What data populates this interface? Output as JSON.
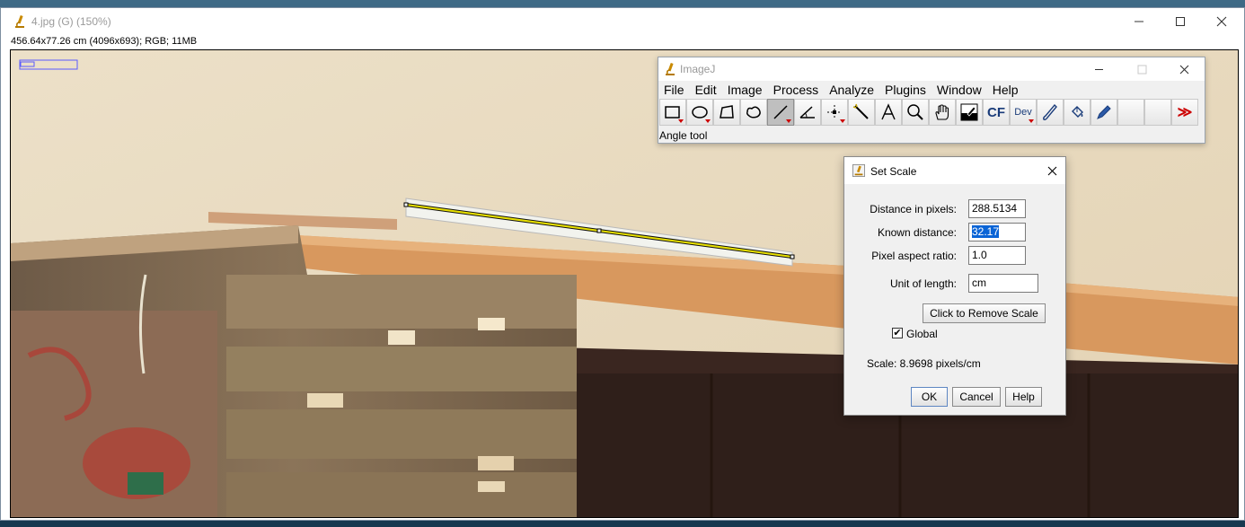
{
  "main_window": {
    "title": "4.jpg (G) (150%)",
    "image_info": "456.64x77.26 cm (4096x693); RGB; 11MB",
    "controls": {
      "minimize": "—",
      "maximize": "☐",
      "close": "✕"
    }
  },
  "imagej_window": {
    "title": "ImageJ",
    "menu": [
      "File",
      "Edit",
      "Image",
      "Process",
      "Analyze",
      "Plugins",
      "Window",
      "Help"
    ],
    "tools": [
      {
        "name": "rectangle-tool-icon"
      },
      {
        "name": "oval-tool-icon"
      },
      {
        "name": "polygon-tool-icon"
      },
      {
        "name": "freehand-tool-icon"
      },
      {
        "name": "line-tool-icon",
        "selected": true
      },
      {
        "name": "angle-tool-icon"
      },
      {
        "name": "point-tool-icon"
      },
      {
        "name": "wand-tool-icon"
      },
      {
        "name": "text-tool-icon"
      },
      {
        "name": "magnifier-tool-icon"
      },
      {
        "name": "hand-tool-icon"
      },
      {
        "name": "color-picker-icon"
      },
      {
        "name": "cf-tool",
        "label": "CF"
      },
      {
        "name": "dev-tool",
        "label": "Dev"
      },
      {
        "name": "brush-tool-icon"
      },
      {
        "name": "flood-fill-tool-icon"
      },
      {
        "name": "pencil-tool-icon"
      },
      {
        "name": "empty-slot-1"
      },
      {
        "name": "empty-slot-2"
      },
      {
        "name": "more-tools-icon",
        "label": "≫"
      }
    ],
    "status": "Angle tool"
  },
  "set_scale": {
    "title": "Set Scale",
    "distance_in_pixels_label": "Distance in pixels:",
    "distance_in_pixels": "288.5134",
    "known_distance_label": "Known distance:",
    "known_distance": "32.17",
    "pixel_aspect_ratio_label": "Pixel aspect ratio:",
    "pixel_aspect_ratio": "1.0",
    "unit_of_length_label": "Unit of length:",
    "unit_of_length": "cm",
    "remove_scale_label": "Click to Remove Scale",
    "global_label": "Global",
    "global_checked": true,
    "scale_text": "Scale: 8.9698 pixels/cm",
    "ok_label": "OK",
    "cancel_label": "Cancel",
    "help_label": "Help"
  },
  "colors": {
    "wall": "#e9dcc3",
    "plank": "#d99a63",
    "crate": "#8a7258",
    "selection_line": "#e8e000"
  }
}
